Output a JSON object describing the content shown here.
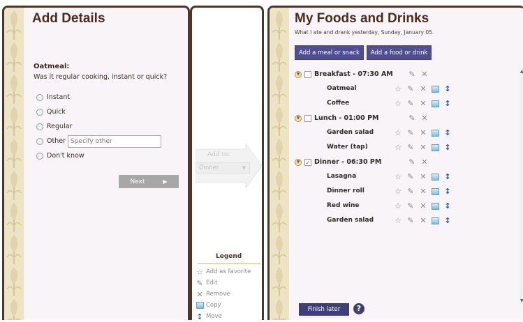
{
  "add_details": {
    "title": "Add Details",
    "question_food": "Oatmeal:",
    "question_text": "Was it regular cooking, instant or quick?",
    "options": [
      "Instant",
      "Quick",
      "Regular",
      "Other",
      "Don't know"
    ],
    "other_placeholder": "Specify other",
    "next_label": "Next",
    "next_arrow": "▶"
  },
  "add_to": {
    "label": "Add to:",
    "selected": "Dinner"
  },
  "legend": {
    "title": "Legend",
    "items": [
      {
        "label": "Add as favorite",
        "icon": "star-icon"
      },
      {
        "label": "Edit",
        "icon": "edit-icon"
      },
      {
        "label": "Remove",
        "icon": "remove-icon"
      },
      {
        "label": "Copy",
        "icon": "copy-icon"
      },
      {
        "label": "Move",
        "icon": "move-icon"
      }
    ]
  },
  "my_foods": {
    "title": "My Foods and Drinks",
    "subtitle": "What I ate and drank yesterday, Sunday, January 05.",
    "add_meal_label": "Add a meal or snack",
    "add_food_label": "Add a food or drink",
    "meals": [
      {
        "name": "Breakfast - 07:30 AM",
        "checked": false,
        "foods": [
          "Oatmeal",
          "Coffee"
        ]
      },
      {
        "name": "Lunch - 01:00 PM",
        "checked": false,
        "foods": [
          "Garden salad",
          "Water (tap)"
        ]
      },
      {
        "name": "Dinner - 06:30 PM",
        "checked": true,
        "foods": [
          "Lasagna",
          "Dinner roll",
          "Red wine",
          "Garden salad"
        ]
      }
    ],
    "finish_label": "Finish later",
    "help_label": "?"
  },
  "colors": {
    "frame": "#4e3526",
    "title": "#4a2c1a",
    "button": "#4f4f8f",
    "button_dark": "#3e3e78",
    "deco": "#ece4c4",
    "panel_bg": "#f8f4f8"
  }
}
